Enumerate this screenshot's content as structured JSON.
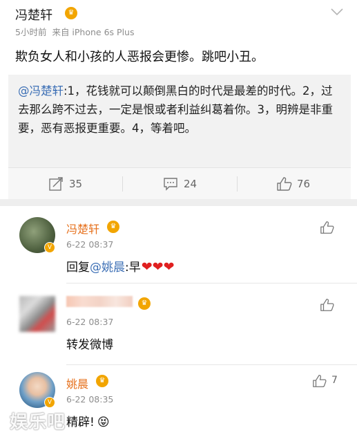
{
  "post": {
    "username": "冯楚轩",
    "time": "5小时前",
    "source": "来自 iPhone 6s Plus",
    "text": "欺负女人和小孩的人恶报会更惨。跳吧小丑。",
    "quote_at": "@冯楚轩",
    "quote_text": ":1，花钱就可以颠倒黑白的时代是最差的时代。2，过去那么跨不过去，一定是恨或者利益纠葛着你。3，明辨是非重要，恶有恶报更重要。4，等着吧。",
    "actions": {
      "repost_count": "35",
      "comment_count": "24",
      "like_count": "76"
    }
  },
  "comments": [
    {
      "name": "冯楚轩",
      "time": "6-22 08:37",
      "text_prefix": "回复",
      "text_at": "@姚晨",
      "text_suffix": ":早",
      "hearts": "❤❤❤"
    },
    {
      "name": "",
      "time": "6-22 08:37",
      "text": "转发微博"
    },
    {
      "name": "姚晨",
      "time": "6-22 08:35",
      "text": "精辟!",
      "emoji": "😝",
      "like_count": "7"
    }
  ],
  "watermark": "娱乐吧",
  "colors": {
    "link": "#3c6fb5",
    "comment_name": "#e6701c",
    "vip": "#f2a500",
    "heart": "#e02020"
  }
}
